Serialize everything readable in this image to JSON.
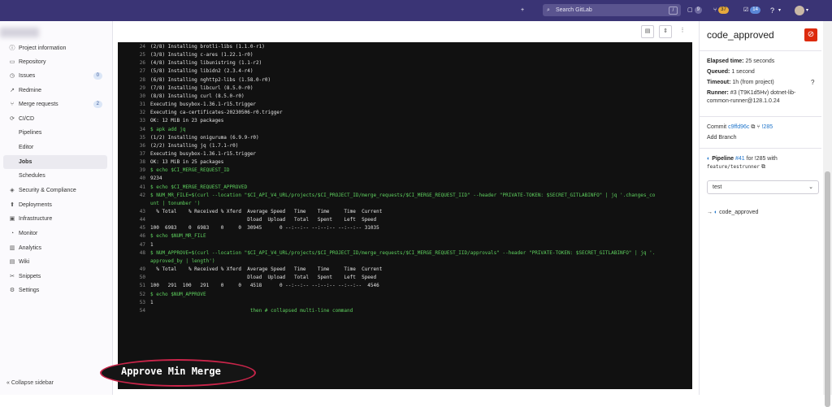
{
  "topbar": {
    "search_placeholder": "Search GitLab",
    "search_shortcut": "/",
    "issues_count": "9",
    "mr_count": "37",
    "todos_count": "14",
    "help_icon": "?",
    "plus_icon": "+"
  },
  "sidebar": {
    "items": [
      {
        "label": "Project information",
        "icon": "ⓘ"
      },
      {
        "label": "Repository",
        "icon": "▭"
      },
      {
        "label": "Issues",
        "icon": "◷",
        "count": "0"
      },
      {
        "label": "Redmine",
        "icon": "↗"
      },
      {
        "label": "Merge requests",
        "icon": "⑂",
        "count": "2"
      },
      {
        "label": "CI/CD",
        "icon": "⟳"
      },
      {
        "label": "Pipelines"
      },
      {
        "label": "Editor"
      },
      {
        "label": "Jobs"
      },
      {
        "label": "Schedules"
      },
      {
        "label": "Security & Compliance",
        "icon": "◈"
      },
      {
        "label": "Deployments",
        "icon": "⬆"
      },
      {
        "label": "Infrastructure",
        "icon": "▣"
      },
      {
        "label": "Monitor",
        "icon": "◔"
      },
      {
        "label": "Analytics",
        "icon": "▥"
      },
      {
        "label": "Wiki",
        "icon": "▤"
      },
      {
        "label": "Snippets",
        "icon": "✂"
      },
      {
        "label": "Settings",
        "icon": "⚙"
      }
    ],
    "collapse_label": "Collapse sidebar"
  },
  "log": [
    {
      "n": "24",
      "t": "(2/8) Installing brotli-libs (1.1.0-r1)"
    },
    {
      "n": "25",
      "t": "(3/8) Installing c-ares (1.22.1-r0)"
    },
    {
      "n": "26",
      "t": "(4/8) Installing libunistring (1.1-r2)"
    },
    {
      "n": "27",
      "t": "(5/8) Installing libidn2 (2.3.4-r4)"
    },
    {
      "n": "28",
      "t": "(6/8) Installing nghttp2-libs (1.58.0-r0)"
    },
    {
      "n": "29",
      "t": "(7/8) Installing libcurl (8.5.0-r0)"
    },
    {
      "n": "30",
      "t": "(8/8) Installing curl (8.5.0-r0)"
    },
    {
      "n": "31",
      "t": "Executing busybox-1.36.1-r15.trigger"
    },
    {
      "n": "32",
      "t": "Executing ca-certificates-20230506-r0.trigger"
    },
    {
      "n": "33",
      "t": "OK: 12 MiB in 23 packages"
    },
    {
      "n": "34",
      "t": "$ apk add jq",
      "g": true
    },
    {
      "n": "35",
      "t": "(1/2) Installing oniguruma (6.9.9-r0)"
    },
    {
      "n": "36",
      "t": "(2/2) Installing jq (1.7.1-r0)"
    },
    {
      "n": "37",
      "t": "Executing busybox-1.36.1-r15.trigger"
    },
    {
      "n": "38",
      "t": "OK: 13 MiB in 25 packages"
    },
    {
      "n": "39",
      "t": "$ echo $CI_MERGE_REQUEST_ID",
      "g": true
    },
    {
      "n": "40",
      "t": "9234"
    },
    {
      "n": "41",
      "t": "$ echo $CI_MERGE_REQUEST_APPROVED",
      "g": true
    },
    {
      "n": "42",
      "t": "$ NUM_MR_FILE=$(curl --location \"$CI_API_V4_URL/projects/$CI_PROJECT_ID/merge_requests/$CI_MERGE_REQUEST_IID\" --header \"PRIVATE-TOKEN: $SECRET_GITLABINFO\" | jq '.changes_co",
      "g": true
    },
    {
      "n": "",
      "t": "unt | tonumber ')",
      "g": true
    },
    {
      "n": "43",
      "t": "  % Total    % Received % Xferd  Average Speed   Time    Time     Time  Current"
    },
    {
      "n": "44",
      "t": "                                 Dload  Upload   Total   Spent    Left  Speed"
    },
    {
      "n": "45",
      "t": "100  6983    0  6983    0     0  30945      0 --:--:-- --:--:-- --:--:-- 31035"
    },
    {
      "n": "46",
      "t": "$ echo $NUM_MR_FILE",
      "g": true
    },
    {
      "n": "47",
      "t": "1"
    },
    {
      "n": "48",
      "t": "$ NUM_APPROVE=$(curl --location \"$CI_API_V4_URL/projects/$CI_PROJECT_ID/merge_requests/$CI_MERGE_REQUEST_IID/approvals\" --header \"PRIVATE-TOKEN: $SECRET_GITLABINFO\" | jq '.",
      "g": true
    },
    {
      "n": "",
      "t": "approved_by | length')",
      "g": true
    },
    {
      "n": "49",
      "t": "  % Total    % Received % Xferd  Average Speed   Time    Time     Time  Current"
    },
    {
      "n": "50",
      "t": "                                 Dload  Upload   Total   Spent    Left  Speed"
    },
    {
      "n": "51",
      "t": "100   291  100   291    0     0   4518      0 --:--:-- --:--:-- --:--:--  4546"
    },
    {
      "n": "52",
      "t": "$ echo $NUM_APPROVE",
      "g": true
    },
    {
      "n": "53",
      "t": "1"
    },
    {
      "n": "54",
      "t": "                                  then # collapsed multi-line command",
      "g": true
    }
  ],
  "overlay_label": "Approve Min Merge",
  "right": {
    "job_title": "code_approved",
    "elapsed_label": "Elapsed time:",
    "elapsed_value": "25 seconds",
    "queued_label": "Queued:",
    "queued_value": "1 second",
    "timeout_label": "Timeout:",
    "timeout_value": "1h (from project)",
    "runner_label": "Runner:",
    "runner_value_1": "#3 (T9K1d5Hv) dotnet-lib-",
    "runner_value_2": "common-runner@128.1.0.24",
    "commit_label": "Commit",
    "commit_sha": "c9ffd96c",
    "commit_ref": "!285",
    "add_branch": "Add Branch",
    "pipeline_label": "Pipeline",
    "pipeline_id": "#41",
    "pipeline_for": "for !285 with",
    "pipeline_branch": "feature/testrunner",
    "stage_select": "test",
    "job_link": "code_approved"
  },
  "colors": {
    "topbar": "#3a3475",
    "terminal_bg": "#111111",
    "log_green": "#5ed05e",
    "cancel_red": "#dd2b0e",
    "overlay_ring": "#c9254a"
  }
}
